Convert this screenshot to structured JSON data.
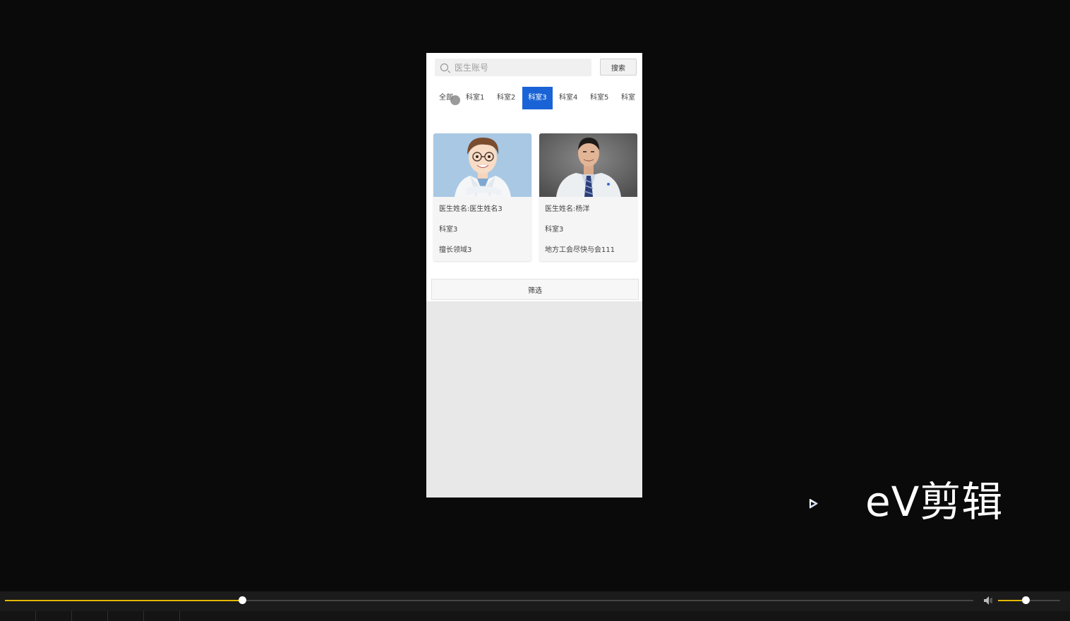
{
  "search": {
    "placeholder": "医生账号",
    "button_label": "搜索"
  },
  "tabs": [
    {
      "label": "全部",
      "active": false
    },
    {
      "label": "科室1",
      "active": false
    },
    {
      "label": "科室2",
      "active": false
    },
    {
      "label": "科室3",
      "active": true
    },
    {
      "label": "科室4",
      "active": false
    },
    {
      "label": "科室5",
      "active": false
    },
    {
      "label": "科室",
      "active": false
    }
  ],
  "doctors": [
    {
      "name": "医生姓名:医生姓名3",
      "department": "科室3",
      "specialty": "擅长领域3"
    },
    {
      "name": "医生姓名:杨洋",
      "department": "科室3",
      "specialty": "地方工会尽快与会111"
    }
  ],
  "filter_button_label": "筛选",
  "watermark": {
    "brand_text": "eV剪辑"
  },
  "player": {
    "progress_fraction": 0.245,
    "volume_fraction": 0.44
  },
  "colors": {
    "accent_blue": "#1a63d6",
    "progress_yellow": "#e5b800"
  }
}
